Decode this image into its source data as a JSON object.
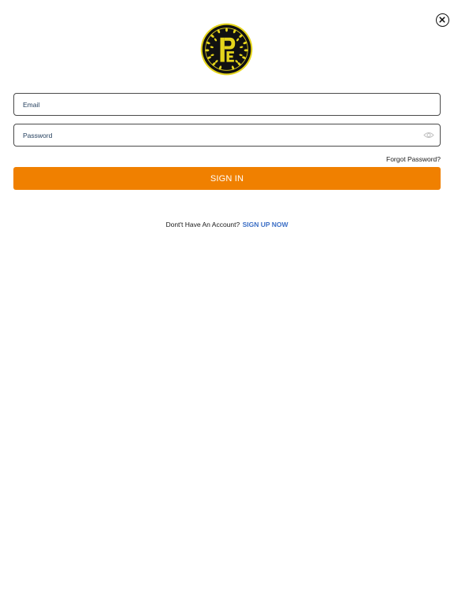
{
  "header": {
    "logo_icon": "crest-logo-icon",
    "close_icon": "close-circle-icon"
  },
  "form": {
    "email": {
      "placeholder": "Email",
      "value": ""
    },
    "password": {
      "placeholder": "Password",
      "value": "",
      "toggle_icon": "eye-icon"
    },
    "forgot_password_label": "Forgot Password?",
    "sign_in_label": "SIGN IN"
  },
  "footer": {
    "prompt": "Dont't Have An Account?",
    "sign_up_label": "SIGN UP NOW"
  },
  "colors": {
    "accent": "#f08000",
    "link": "#3c6fc6",
    "logo_gold": "#e5d51b",
    "logo_dark": "#111111"
  }
}
